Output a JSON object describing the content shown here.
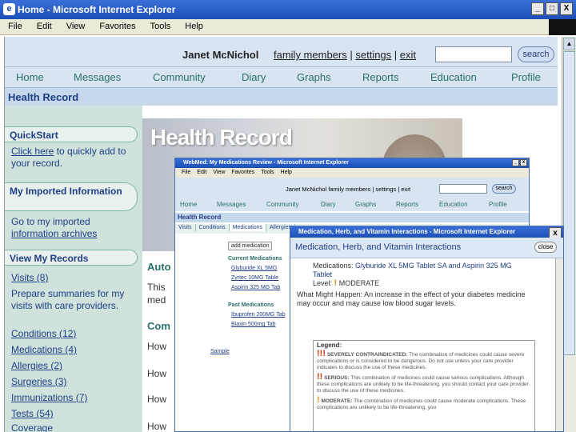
{
  "window": {
    "title": "Home - Microsoft Internet Explorer",
    "min": "_",
    "max": "□",
    "close": "X"
  },
  "menu": [
    "File",
    "Edit",
    "View",
    "Favorites",
    "Tools",
    "Help"
  ],
  "user": {
    "name": "Janet McNichol",
    "links": [
      "family members",
      "settings",
      "exit"
    ],
    "search_label": "search"
  },
  "nav": [
    "Home",
    "Messages",
    "Community",
    "Diary",
    "Graphs",
    "Reports",
    "Education",
    "Profile"
  ],
  "section_title": "Health Record",
  "banner_title": "Health Record",
  "quickstart": {
    "heading": "QuickStart",
    "link": "Click here",
    "rest": " to quickly add to your record."
  },
  "imported": {
    "heading": "My Imported Information",
    "text": "Go to my imported ",
    "link": "information archives"
  },
  "view_records": {
    "heading": "View My Records",
    "visits": "Visits (8)",
    "visits_desc": "Prepare summaries for my visits with care providers.",
    "items": [
      "Conditions (12)",
      "Medications (4)",
      "Allergies (2)",
      "Surgeries (3)",
      "Immunizations (7)",
      "Tests (54)",
      "Coverage"
    ]
  },
  "middle": {
    "h1": "Auto",
    "p1": "This",
    "p1b": "med",
    "h2": "Com",
    "how": [
      "How",
      "How",
      "How",
      "How"
    ]
  },
  "w2": {
    "title": "WebMed: My Medications Review - Microsoft Internet Explorer",
    "menu": [
      "File",
      "Edit",
      "View",
      "Favorites",
      "Tools",
      "Help"
    ],
    "user": "Janet McNichol  family members | settings | exit",
    "search": "search",
    "nav": [
      "Home",
      "Messages",
      "Community",
      "Diary",
      "Graphs",
      "Reports",
      "Education",
      "Profile"
    ],
    "hr": "Health Record",
    "tabs": [
      "Visits",
      "Conditions",
      "Medications",
      "Allergies"
    ],
    "add": "add medication",
    "current": "Current Medications",
    "meds": [
      "Glyburide XL 5MG",
      "Zyrtec 10MG Table",
      "Aspirin 325 MG Tab"
    ],
    "past": "Past Medications",
    "past_meds": [
      "Ibuprofen 200MG Tab",
      "Biaxin 500mg Tab"
    ],
    "sample": "Sample"
  },
  "w3": {
    "title": "Medication, Herb, and Vitamin Interactions - Microsoft Internet Explorer",
    "heading": "Medication, Herb, and Vitamin Interactions",
    "close": "close",
    "meds_label": "Medications:",
    "meds": "Glyburide XL 5MG Tablet SA and Aspirin 325 MG Tablet",
    "level_label": "Level:",
    "level": "MODERATE",
    "what_label": "What Might Happen:",
    "what": "An increase in the effect of your diabetes medicine may occur and may cause low blood sugar levels.",
    "legend": "Legend:",
    "l1_title": "SEVERELY CONTRAINDICATED:",
    "l1": "The combination of medicines could cause severe complications or is considered to be dangerous. Do not use unless your care provider indicates to discuss the use of these medicines.",
    "l2_title": "SERIOUS:",
    "l2": "This combination of medicines could cause serious complications. Although these complications are unlikely to be life-threatening, you should contact your care provider to discuss the use of these medicines.",
    "l3_title": "MODERATE:",
    "l3": "The combination of medicines could cause moderate complications. These complications are unlikely to be life-threatening, you"
  }
}
